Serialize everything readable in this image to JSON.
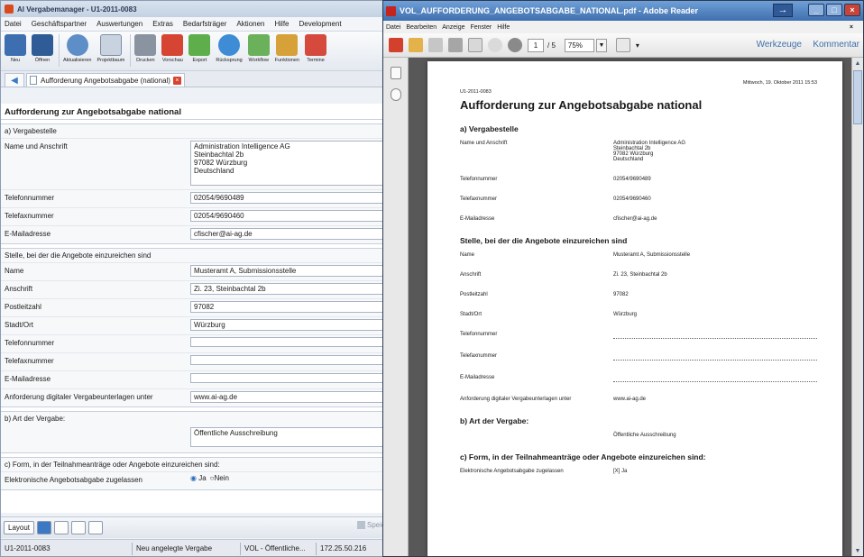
{
  "left": {
    "title": "AI Vergabemanager - U1-2011-0083",
    "menu": [
      "Datei",
      "Geschäftspartner",
      "Auswertungen",
      "Extras",
      "Bedarfsträger",
      "Aktionen",
      "Hilfe",
      "Development"
    ],
    "toolbar": [
      "Neu",
      "Öffnen",
      "Aktualisieren",
      "Projektbaum",
      "Drucken",
      "Vorschau",
      "Export",
      "Rücksprung",
      "Workflow",
      "Funktionen",
      "Termine"
    ],
    "tab_label": "Aufforderung Angebotsabgabe (national)",
    "form_title": "Aufforderung zur Angebotsabgabe national",
    "section_a": {
      "head": "a) Vergabestelle",
      "rows": [
        {
          "label": "Name und Anschrift",
          "value": "Administration Intelligence AG\nSteinbachtal 2b\n97082 Würzburg\nDeutschland"
        },
        {
          "label": "Telefonnummer",
          "value": "02054/9690489"
        },
        {
          "label": "Telefaxnummer",
          "value": "02054/9690460"
        },
        {
          "label": "E-Mailadresse",
          "value": "cfischer@ai-ag.de"
        }
      ]
    },
    "section_stelle": {
      "head": "Stelle, bei der die Angebote einzureichen sind",
      "rows": [
        {
          "label": "Name",
          "value": "Musteramt A, Submissionsstelle"
        },
        {
          "label": "Anschrift",
          "value": "Zi. 23, Steinbachtal 2b"
        },
        {
          "label": "Postleitzahl",
          "value": "97082"
        },
        {
          "label": "Stadt/Ort",
          "value": "Würzburg"
        },
        {
          "label": "Telefonnummer",
          "value": ""
        },
        {
          "label": "Telefaxnummer",
          "value": ""
        },
        {
          "label": "E-Mailadresse",
          "value": ""
        },
        {
          "label": "Anforderung digitaler Vergabeunterlagen unter",
          "value": "www.ai-ag.de"
        }
      ]
    },
    "section_b": {
      "head": "b) Art der Vergabe:",
      "value": "Öffentliche Ausschreibung"
    },
    "section_c": {
      "head": "c) Form, in der Teilnahmeanträge oder Angebote einzureichen sind:",
      "row_label": "Elektronische Angebotsabgabe zugelassen",
      "radio_ja": "Ja",
      "radio_nein": "Nein"
    },
    "bottom": {
      "layout_label": "Layout",
      "save_label": "Speic"
    },
    "status": [
      "U1-2011-0083",
      "Neu angelegte Vergabe",
      "VOL - Öffentliche...",
      "172.25.50.216"
    ]
  },
  "right": {
    "title": "VOL_AUFFORDERUNG_ANGEBOTSABGABE_NATIONAL.pdf - Adobe Reader",
    "menu": [
      "Datei",
      "Bearbeiten",
      "Anzeige",
      "Fenster",
      "Hilfe"
    ],
    "close_menu": "×",
    "page_current": "1",
    "page_total": "/ 5",
    "zoom": "75%",
    "werkzeuge": "Werkzeuge",
    "kommentar": "Kommentar",
    "pdf": {
      "doc_id": "U1-2011-0083",
      "date": "Mittwoch, 19. Oktober 2011 15:53",
      "h1": "Aufforderung zur Angebotsabgabe national",
      "sec_a": "a) Vergabestelle",
      "rows_a": [
        {
          "label": "Name und Anschrift",
          "value": "Administration Intelligence AG\nSteinbachtal 2b\n97082 Würzburg\nDeutschland"
        },
        {
          "label": "Telefonnummer",
          "value": "02054/9690489"
        },
        {
          "label": "Telefaxnummer",
          "value": "02054/9690460"
        },
        {
          "label": "E-Mailadresse",
          "value": "cfischer@ai-ag.de"
        }
      ],
      "sec_stelle": "Stelle, bei der die Angebote einzureichen sind",
      "rows_stelle": [
        {
          "label": "Name",
          "value": "Musteramt A, Submissionsstelle"
        },
        {
          "label": "Anschrift",
          "value": "Zi. 23, Steinbachtal 2b"
        },
        {
          "label": "Postleitzahl",
          "value": "97082"
        },
        {
          "label": "Stadt/Ort",
          "value": "Würzburg"
        },
        {
          "label": "Telefonnummer",
          "value": ""
        },
        {
          "label": "Telefaxnummer",
          "value": ""
        },
        {
          "label": "E-Mailadresse",
          "value": ""
        },
        {
          "label": "Anforderung digitaler Vergabeunterlagen unter",
          "value": "www.ai-ag.de"
        }
      ],
      "sec_b": "b) Art der Vergabe:",
      "b_value": "Öffentliche Ausschreibung",
      "sec_c": "c) Form, in der Teilnahmeanträge oder Angebote einzureichen sind:",
      "c_label": "Elektronische Angebotsabgabe zugelassen",
      "c_value": "[X]  Ja"
    }
  }
}
